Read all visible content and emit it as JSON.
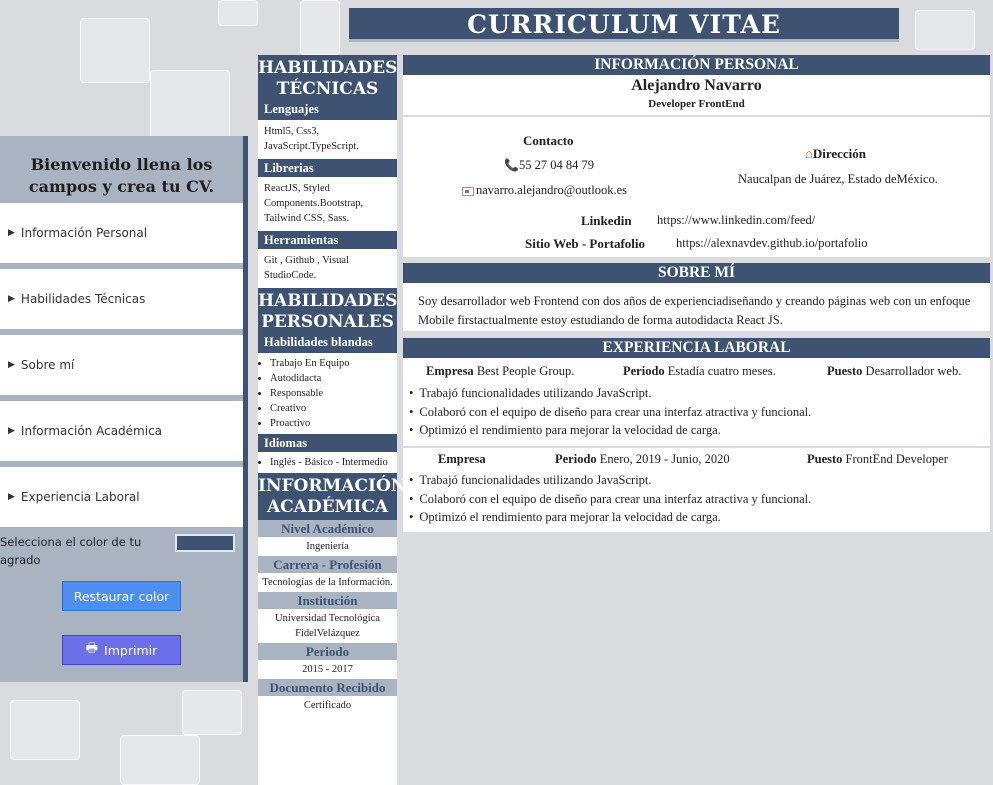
{
  "form": {
    "title": "Bienvenido llena los campos y crea tu CV.",
    "sections": [
      {
        "label": "Información Personal"
      },
      {
        "label": "Habilidades Técnicas"
      },
      {
        "label": "Sobre mí"
      },
      {
        "label": "Información Académica"
      },
      {
        "label": "Experiencia Laboral"
      }
    ],
    "color_label": "Selecciona el color de tu agrado",
    "color_value": "#3e5272",
    "restore_button": "Restaurar color",
    "print_button": "Imprimir"
  },
  "cv": {
    "title": "CURRICULUM VITAE",
    "technical": {
      "heading": "HABILIDADES TÉCNICAS",
      "languages_label": "Lenguajes",
      "languages": "Html5, Css3, JavaScript.TypeScript.",
      "libraries_label": "Librerias",
      "libraries": "ReactJS, Styled Components.Bootstrap, Tailwind CSS, Sass.",
      "tools_label": "Herramientas",
      "tools": "Git , Github , Visual StudioCode."
    },
    "personal_skills": {
      "heading": "HABILIDADES PERSONALES",
      "soft_label": "Habilidades blandas",
      "soft": [
        "Trabajo En Equipo",
        "Autodidacta",
        "Responsable",
        "Creativo",
        "Proactivo"
      ],
      "languages_label": "Idiomas",
      "languages": [
        "Inglés - Básico - Intermedio"
      ]
    },
    "academic": {
      "heading": "INFORMACIÓN ACADÉMICA",
      "level_label": "Nivel Académico",
      "level": "Ingeniería",
      "career_label": "Carrera - Profesión",
      "career": "Tecnologías de la Información.",
      "institution_label": "Institución",
      "institution": "Universidad Tecnológica FidelVelázquez",
      "period_label": "Periodo",
      "period": "2015 - 2017",
      "document_label": "Documento Recibido",
      "document": "Certificado"
    },
    "personal": {
      "heading": "INFORMACIÓN PERSONAL",
      "name": "Alejandro Navarro",
      "role": "Developer FrontEnd",
      "contact_label": "Contacto",
      "phone": "55 27 04 84 79",
      "email": "navarro.alejandro@outlook.es",
      "address_label": "Dirección",
      "address": "Naucalpan de Juárez, Estado deMéxico.",
      "linkedin_label": "Linkedin",
      "linkedin": "https://www.linkedin.com/feed/",
      "website_label": "Sitio Web - Portafolio",
      "website": "https://alexnavdev.github.io/portafolio"
    },
    "about": {
      "heading": "SOBRE MÍ",
      "text": "Soy desarrollador web Frontend con dos años de experienciadiseñando y creando páginas web con un enfoque Mobile firstactualmente estoy estudiando de forma autodidacta React JS."
    },
    "experience": {
      "heading": "EXPERIENCIA LABORAL",
      "company_label": "Empresa",
      "period_label": "Periodo",
      "position_label": "Puesto",
      "jobs": [
        {
          "company": "Best People Group.",
          "period": "Estadía cuatro meses.",
          "position": "Desarrollador web.",
          "bullets": [
            "Trabajó funcionalidades utilizando JavaScript.",
            "Colaboró con el equipo de diseño para crear una interfaz atractiva y funcional.",
            "Optimizó el rendimiento para mejorar la velocidad de carga."
          ]
        },
        {
          "company": "",
          "period": "Enero, 2019 - Junio, 2020",
          "position": "FrontEnd Developer",
          "bullets": [
            "Trabajó funcionalidades utilizando JavaScript.",
            "Colaboró con el equipo de diseño para crear una interfaz atractiva y funcional.",
            "Optimizó el rendimiento para mejorar la velocidad de carga."
          ]
        }
      ]
    }
  }
}
